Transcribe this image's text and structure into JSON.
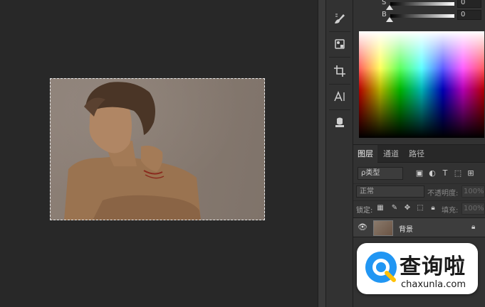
{
  "color_sliders": [
    {
      "channel": "S",
      "value": "0"
    },
    {
      "channel": "B",
      "value": "0"
    }
  ],
  "tools": [
    {
      "name": "brush-tool-icon"
    },
    {
      "name": "clone-tool-icon"
    },
    {
      "name": "crop-tool-icon"
    },
    {
      "name": "text-tool-icon"
    },
    {
      "name": "stamp-tool-icon"
    }
  ],
  "layers_panel": {
    "tabs": [
      "图层",
      "通道",
      "路径"
    ],
    "active_tab": "图层",
    "filter_kind": "ρ类型",
    "blend_mode": "正常",
    "opacity_label": "不透明度:",
    "opacity_value": "100%",
    "lock_label": "锁定:",
    "fill_label": "填充:",
    "fill_value": "100%",
    "layers": [
      {
        "name": "背景",
        "visible": true,
        "locked": true
      }
    ]
  },
  "watermark": {
    "title": "查询啦",
    "url": "chaxunla.com"
  },
  "colors": {
    "canvas_bg": "#282828",
    "panel_bg": "#323232",
    "watermark_accent": "#2196f3"
  }
}
